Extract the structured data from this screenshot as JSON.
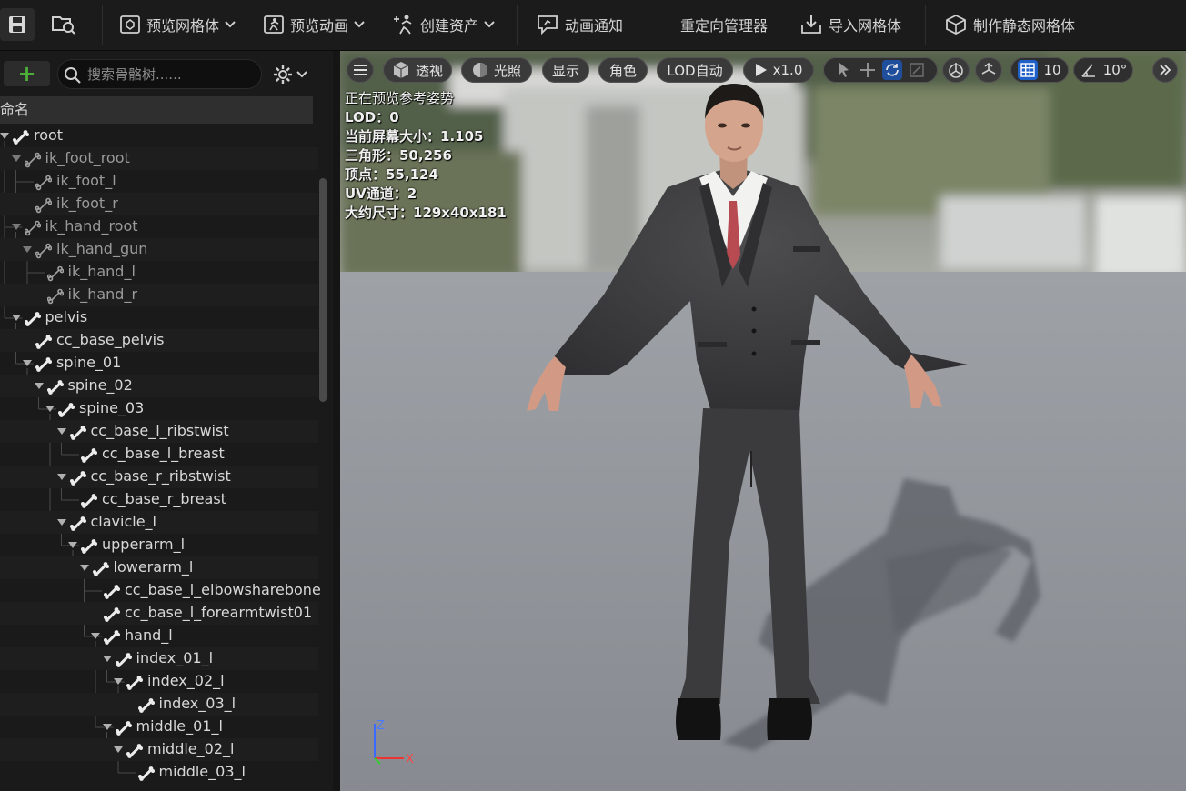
{
  "toolbar": {
    "preview_mesh": "预览网格体",
    "preview_anim": "预览动画",
    "create_asset": "创建资产",
    "anim_notify": "动画通知",
    "retarget_manager": "重定向管理器",
    "import_mesh": "导入网格体",
    "make_static_mesh": "制作静态网格体"
  },
  "skeleton_panel": {
    "search_placeholder": "搜索骨骼树......",
    "column_name": "命名",
    "bones": [
      {
        "name": "root",
        "depth": 0,
        "dim": false
      },
      {
        "name": "ik_foot_root",
        "depth": 1,
        "dim": true
      },
      {
        "name": "ik_foot_l",
        "depth": 2,
        "dim": true
      },
      {
        "name": "ik_foot_r",
        "depth": 2,
        "dim": true
      },
      {
        "name": "ik_hand_root",
        "depth": 1,
        "dim": true
      },
      {
        "name": "ik_hand_gun",
        "depth": 2,
        "dim": true
      },
      {
        "name": "ik_hand_l",
        "depth": 3,
        "dim": true
      },
      {
        "name": "ik_hand_r",
        "depth": 3,
        "dim": true
      },
      {
        "name": "pelvis",
        "depth": 1,
        "dim": false
      },
      {
        "name": "cc_base_pelvis",
        "depth": 2,
        "dim": false
      },
      {
        "name": "spine_01",
        "depth": 2,
        "dim": false
      },
      {
        "name": "spine_02",
        "depth": 3,
        "dim": false
      },
      {
        "name": "spine_03",
        "depth": 4,
        "dim": false
      },
      {
        "name": "cc_base_l_ribstwist",
        "depth": 5,
        "dim": false
      },
      {
        "name": "cc_base_l_breast",
        "depth": 6,
        "dim": false
      },
      {
        "name": "cc_base_r_ribstwist",
        "depth": 5,
        "dim": false
      },
      {
        "name": "cc_base_r_breast",
        "depth": 6,
        "dim": false
      },
      {
        "name": "clavicle_l",
        "depth": 5,
        "dim": false
      },
      {
        "name": "upperarm_l",
        "depth": 6,
        "dim": false
      },
      {
        "name": "lowerarm_l",
        "depth": 7,
        "dim": false
      },
      {
        "name": "cc_base_l_elbowsharebone",
        "depth": 8,
        "dim": false
      },
      {
        "name": "cc_base_l_forearmtwist01",
        "depth": 8,
        "dim": false
      },
      {
        "name": "hand_l",
        "depth": 8,
        "dim": false
      },
      {
        "name": "index_01_l",
        "depth": 9,
        "dim": false
      },
      {
        "name": "index_02_l",
        "depth": 10,
        "dim": false
      },
      {
        "name": "index_03_l",
        "depth": 11,
        "dim": false
      },
      {
        "name": "middle_01_l",
        "depth": 9,
        "dim": false
      },
      {
        "name": "middle_02_l",
        "depth": 10,
        "dim": false
      },
      {
        "name": "middle_03_l",
        "depth": 11,
        "dim": false
      }
    ]
  },
  "viewport": {
    "perspective": "透视",
    "lighting": "光照",
    "show": "显示",
    "character": "角色",
    "lod": "LOD自动",
    "speed": "x1.0",
    "grid_size": "10",
    "rot_snap": "10°",
    "stats": [
      "正在预览参考姿势",
      "LOD：0",
      "当前屏幕大小：1.105",
      "三角形：50,256",
      "顶点：55,124",
      "UV通道：2",
      "大约尺寸：129x40x181"
    ],
    "axis_z": "Z",
    "axis_x": "X"
  }
}
